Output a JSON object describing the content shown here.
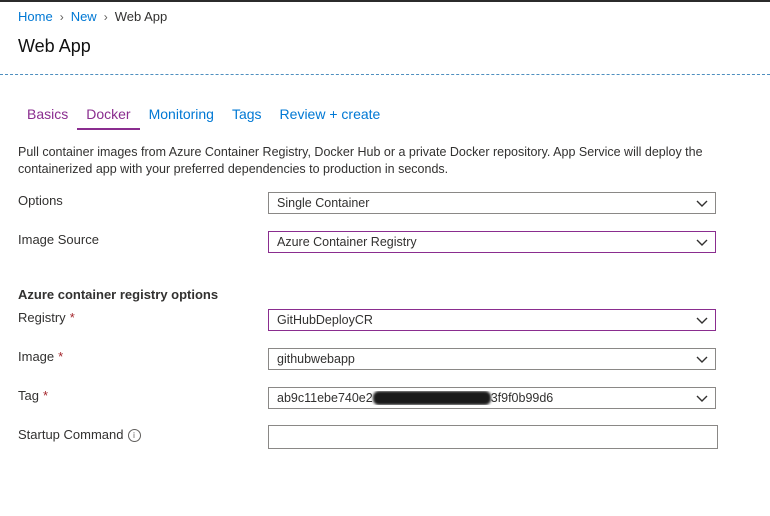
{
  "breadcrumb": {
    "items": [
      "Home",
      "New"
    ],
    "current": "Web App"
  },
  "page": {
    "title": "Web App"
  },
  "tabs": [
    {
      "label": "Basics"
    },
    {
      "label": "Docker"
    },
    {
      "label": "Monitoring"
    },
    {
      "label": "Tags"
    },
    {
      "label": "Review + create"
    }
  ],
  "active_tab": "Docker",
  "intro": "Pull container images from Azure Container Registry, Docker Hub or a private Docker repository. App Service will deploy the containerized app with your preferred dependencies to production in seconds.",
  "form": {
    "options": {
      "label": "Options",
      "value": "Single Container"
    },
    "image_source": {
      "label": "Image Source",
      "value": "Azure Container Registry"
    },
    "acr_section": "Azure container registry options",
    "registry": {
      "label": "Registry",
      "value": "GitHubDeployCR",
      "required": "*"
    },
    "image": {
      "label": "Image",
      "value": "githubwebapp",
      "required": "*"
    },
    "tag": {
      "label": "Tag",
      "value_start": "ab9c11ebe740e2",
      "value_end": "3f9f0b99d6",
      "required": "*"
    },
    "startup": {
      "label": "Startup Command",
      "value": ""
    }
  },
  "icons": {
    "info": "info-icon",
    "chevron": "chevron-down-icon"
  },
  "colors": {
    "accent": "#8a2d8f",
    "link": "#0078d4",
    "required": "#a4262c"
  }
}
